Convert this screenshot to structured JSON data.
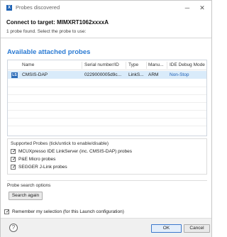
{
  "window": {
    "title": "Probes discovered",
    "icon_label": "X",
    "minimize_glyph": "─",
    "close_glyph": "✕"
  },
  "header": {
    "title": "Connect to target: MIMXRT1062xxxxA",
    "subtitle": "1 probe found. Select the probe to use:"
  },
  "section_title": "Available attached probes",
  "table": {
    "columns": [
      "Name",
      "Serial number/ID",
      "Type",
      "Manu...",
      "IDE Debug Mode"
    ],
    "rows": [
      {
        "icon_label": "LS",
        "name": "CMSIS-DAP",
        "serial": "0229000005d9c...",
        "type": "LinkS...",
        "manufacturer": "ARM",
        "mode": "Non-Stop",
        "selected": true
      }
    ]
  },
  "supported_probes": {
    "title": "Supported Probes (tick/untick to enable/disable)",
    "items": [
      {
        "label": "MCUXpresso IDE LinkServer (inc. CMSIS-DAP) probes",
        "checked": true
      },
      {
        "label": "P&E Micro probes",
        "checked": true
      },
      {
        "label": "SEGGER J-Link probes",
        "checked": true
      }
    ]
  },
  "search": {
    "title": "Probe search options",
    "button_label": "Search again"
  },
  "remember": {
    "label": "Remember my selection (for this Launch configuration)",
    "checked": true
  },
  "footer": {
    "help_glyph": "?",
    "ok_label": "OK",
    "cancel_label": "Cancel"
  },
  "colors": {
    "accent": "#2a7ad3",
    "selection": "#d9ebfa",
    "mode_text": "#1d5fb5"
  },
  "check_glyph": "✓"
}
